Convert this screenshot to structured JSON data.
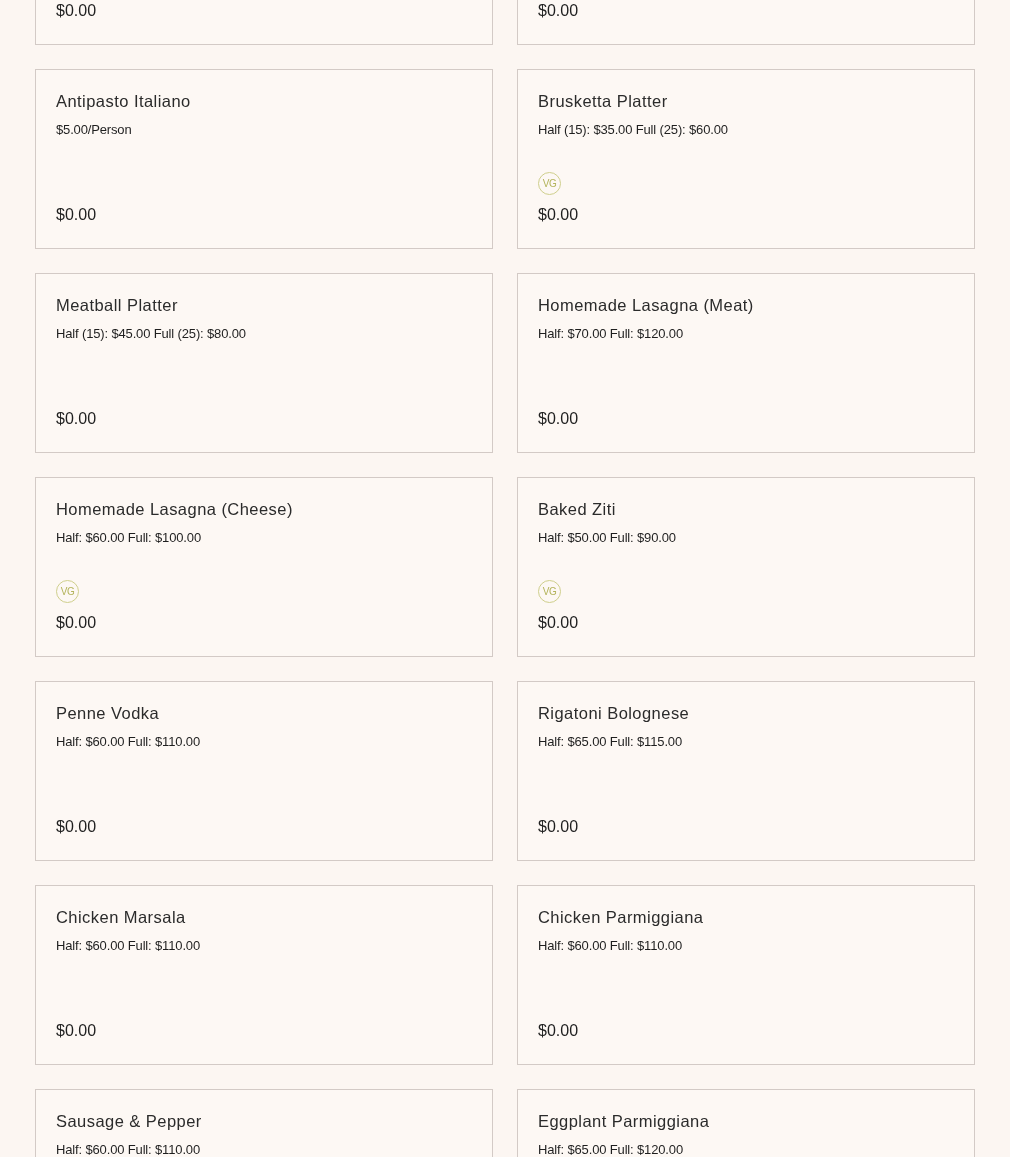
{
  "menu_items": [
    {
      "price": "$0.00"
    },
    {
      "price": "$0.00"
    },
    {
      "name": "Antipasto Italiano",
      "description": "$5.00/Person",
      "price": "$0.00"
    },
    {
      "name": "Brusketta Platter",
      "description": "Half (15): $35.00 Full (25): $60.00",
      "badge": "VG",
      "price": "$0.00"
    },
    {
      "name": "Meatball Platter",
      "description": "Half (15): $45.00 Full (25): $80.00",
      "price": "$0.00"
    },
    {
      "name": "Homemade Lasagna (Meat)",
      "description": "Half: $70.00 Full: $120.00",
      "price": "$0.00"
    },
    {
      "name": "Homemade Lasagna (Cheese)",
      "description": "Half: $60.00 Full: $100.00",
      "badge": "VG",
      "price": "$0.00"
    },
    {
      "name": "Baked Ziti",
      "description": "Half: $50.00 Full: $90.00",
      "badge": "VG",
      "price": "$0.00"
    },
    {
      "name": "Penne Vodka",
      "description": "Half: $60.00 Full: $110.00",
      "price": "$0.00"
    },
    {
      "name": "Rigatoni Bolognese",
      "description": "Half: $65.00 Full: $115.00",
      "price": "$0.00"
    },
    {
      "name": "Chicken Marsala",
      "description": "Half: $60.00 Full: $110.00",
      "price": "$0.00"
    },
    {
      "name": "Chicken Parmiggiana",
      "description": "Half: $60.00 Full: $110.00",
      "price": "$0.00"
    },
    {
      "name": "Sausage & Pepper",
      "description": "Half: $60.00 Full: $110.00"
    },
    {
      "name": "Eggplant Parmiggiana",
      "description": "Half: $65.00 Full: $120.00"
    }
  ]
}
